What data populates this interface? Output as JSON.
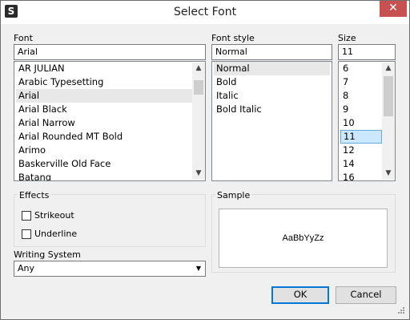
{
  "window": {
    "title": "Select Font",
    "close_symbol": "✕",
    "app_icon_glyph": "S"
  },
  "font": {
    "label": "Font",
    "value": "Arial",
    "items": [
      "AR JULIAN",
      "Arabic Typesetting",
      "Arial",
      "Arial Black",
      "Arial Narrow",
      "Arial Rounded MT Bold",
      "Arimo",
      "Baskerville Old Face",
      "Batang"
    ],
    "selected": "Arial"
  },
  "style": {
    "label": "Font style",
    "value": "Normal",
    "items": [
      "Normal",
      "Bold",
      "Italic",
      "Bold Italic"
    ],
    "selected": "Normal"
  },
  "size": {
    "label": "Size",
    "value": "11",
    "items": [
      "6",
      "7",
      "8",
      "9",
      "10",
      "11",
      "12",
      "14",
      "16"
    ],
    "selected": "11"
  },
  "effects": {
    "label": "Effects",
    "strikeout": "Strikeout",
    "underline": "Underline"
  },
  "sample": {
    "label": "Sample",
    "text": "AaBbYyZz"
  },
  "writing_system": {
    "label": "Writing System",
    "value": "Any"
  },
  "buttons": {
    "ok": "OK",
    "cancel": "Cancel"
  },
  "icons": {
    "scroll_up": "▲",
    "scroll_down": "▼",
    "dropdown": "▼"
  },
  "colors": {
    "selection_blue": "#cce8ff",
    "close_red": "#c75050"
  }
}
